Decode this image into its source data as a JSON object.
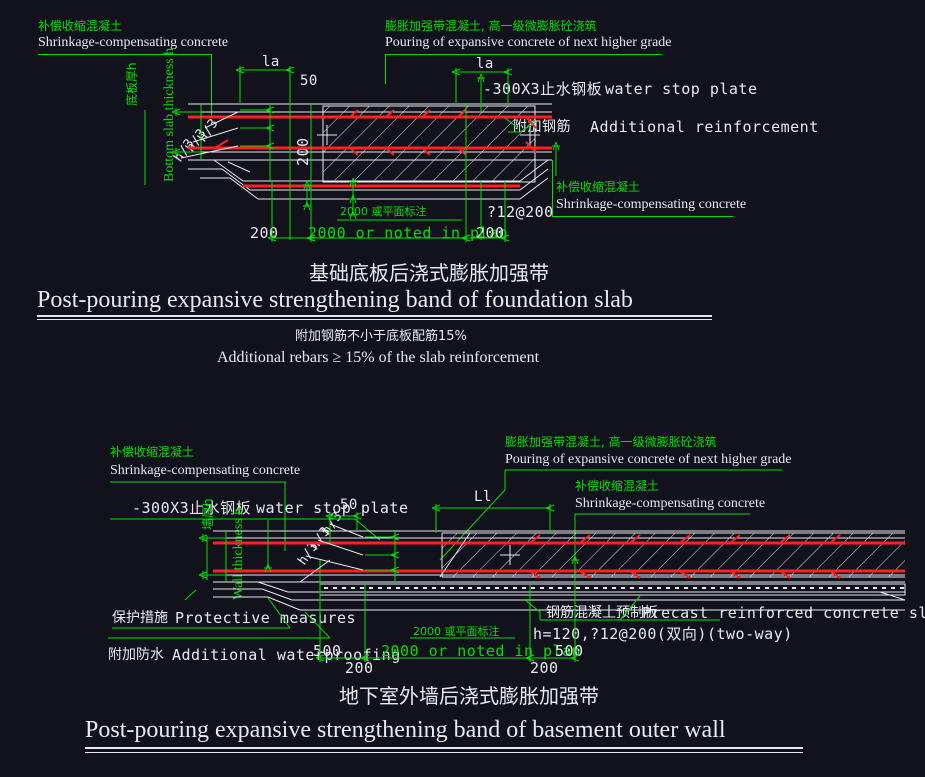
{
  "meta": {
    "background_color": "#12121c",
    "green": "#00e000",
    "red": "#ff2020",
    "white": "#e8e8f0"
  },
  "diagram1": {
    "labels": {
      "top_left_cn": "补偿收缩混凝土",
      "top_left_en": "Shrinkage-compensating concrete",
      "top_right_cn": "膨胀加强带混凝土, 高一级微膨胀砼浇筑",
      "top_right_en": "Pouring of expansive concrete of next higher grade",
      "waterstop_cn": "-300X3止水钢板",
      "waterstop_en": "water stop plate",
      "addreinf_cn": "附加钢筋",
      "addreinf_en": "Additional reinforcement",
      "bottom_right_cn": "补偿收缩混凝土",
      "bottom_right_en": "Shrinkage-compensating concrete",
      "vert_cn": "底板厚h",
      "vert_en": "Bottom slab thickness h",
      "dim_la_left": "la",
      "dim_la_right": "la",
      "dim_50": "50",
      "dim_200_inner": "200",
      "dim_200_left": "200",
      "dim_200_right": "200",
      "span_cn": "2000 或平面标注",
      "span_en": "2000 or noted in plan",
      "rebar_spec": "?12@200",
      "h3_a": "h/3",
      "h3_b": "h/3",
      "h3_c": "h/3"
    },
    "title_cn": "基础底板后浇式膨胀加强带",
    "title_en": "Post-pouring expansive strengthening band of foundation slab",
    "note_cn": "附加钢筋不小于底板配筋15%",
    "note_en": "Additional rebars ≥ 15% of the slab reinforcement"
  },
  "diagram2": {
    "labels": {
      "top_left_cn": "补偿收缩混凝土",
      "top_left_en": "Shrinkage-compensating concrete",
      "waterstop_cn": "-300X3止水钢板",
      "waterstop_en": "water stop plate",
      "top_right_cn": "膨胀加强带混凝土, 高一级微膨胀砼浇筑",
      "top_right_en": "Pouring of expansive concrete of next higher grade",
      "right_cn": "补偿收缩混凝土",
      "right_en": "Shrinkage-compensating concrete",
      "vert_cn": "墙厚h",
      "vert_en": "Wall thickness h",
      "protect_cn": "保护措施",
      "protect_en": "Protective measures",
      "waterproof_cn": "附加防水",
      "waterproof_en": "Additional waterproofing",
      "precast_cn": "钢筋混凝土预制板",
      "precast_en": "Precast reinforced concrete slab",
      "precast_spec": "h=120,?12@200(双向)(two-way)",
      "dim_50": "50",
      "dim_Ll": "Ll",
      "dim_500_left": "500",
      "dim_500_right": "500",
      "dim_200_left": "200",
      "dim_200_right": "200",
      "span_cn": "2000 或平面标注",
      "span_en": "2000 or noted in plan",
      "h3_a": "h/3",
      "h3_b": "h/3",
      "h3_c": "h/3"
    },
    "title_cn": "地下室外墙后浇式膨胀加强带",
    "title_en": "Post-pouring expansive strengthening band of basement outer wall"
  }
}
